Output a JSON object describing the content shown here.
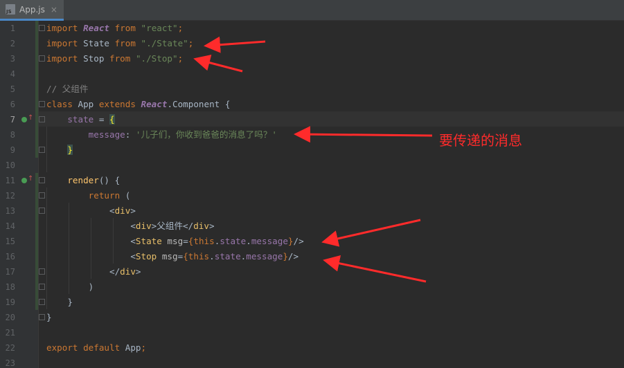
{
  "tab": {
    "label": "App.js",
    "close": "×",
    "icon": "javascript-file-icon"
  },
  "colors": {
    "background": "#2b2b2b",
    "keyword": "#cc7832",
    "string": "#6a8759",
    "annotation": "#ff2b2b"
  },
  "line_numbers": [
    "1",
    "2",
    "3",
    "4",
    "5",
    "6",
    "7",
    "8",
    "9",
    "10",
    "11",
    "12",
    "13",
    "14",
    "15",
    "16",
    "17",
    "18",
    "19",
    "20",
    "21",
    "22",
    "23"
  ],
  "current_line": "7",
  "code": {
    "l1": {
      "kw": "import",
      "cls": "React",
      "from": "from",
      "str": "\"react\"",
      "semi": ";"
    },
    "l2": {
      "kw": "import",
      "name": " State ",
      "from": "from",
      "str": "\"./State\"",
      "semi": ";"
    },
    "l3": {
      "kw": "import",
      "name": " Stop ",
      "from": "from",
      "str": "\"./Stop\"",
      "semi": ";"
    },
    "l5": {
      "comment": "// 父组件"
    },
    "l6": {
      "kw": "class",
      "name": " App ",
      "extends": "extends",
      "cls": "React",
      "rest": ".Component {"
    },
    "l7": {
      "prop": "state",
      "eq": " = ",
      "brace": "{"
    },
    "l8": {
      "prop": "message",
      "colon": ": ",
      "str": "'儿子们，你收到爸爸的消息了吗？'"
    },
    "l9": {
      "brace": "}"
    },
    "l11": {
      "fn": "render",
      "rest": "() {"
    },
    "l12": {
      "kw": "return",
      "rest": " ("
    },
    "l13": {
      "lt": "<",
      "tag": "div",
      "gt": ">"
    },
    "l14": {
      "lt": "<",
      "tag": "div",
      "gt": ">",
      "text": "父组件",
      "close_lt": "</",
      "close_tag": "div",
      "close_gt": ">"
    },
    "l15": {
      "lt": "<",
      "tag": "State",
      "attr": " msg",
      "eq": "=",
      "ob": "{",
      "this": "this",
      "dot1": ".",
      "state": "state",
      "dot2": ".",
      "msg": "message",
      "cb": "}",
      "end": "/>"
    },
    "l16": {
      "lt": "<",
      "tag": "Stop",
      "attr": " msg",
      "eq": "=",
      "ob": "{",
      "this": "this",
      "dot1": ".",
      "state": "state",
      "dot2": ".",
      "msg": "message",
      "cb": "}",
      "end": "/>"
    },
    "l17": {
      "lt": "</",
      "tag": "div",
      "gt": ">"
    },
    "l18": {
      "text": ")"
    },
    "l19": {
      "text": "}"
    },
    "l20": {
      "text": "}"
    },
    "l22": {
      "kw1": "export",
      "kw2": "default",
      "name": " App",
      "semi": ";"
    }
  },
  "annotation": {
    "text": "要传递的消息"
  }
}
